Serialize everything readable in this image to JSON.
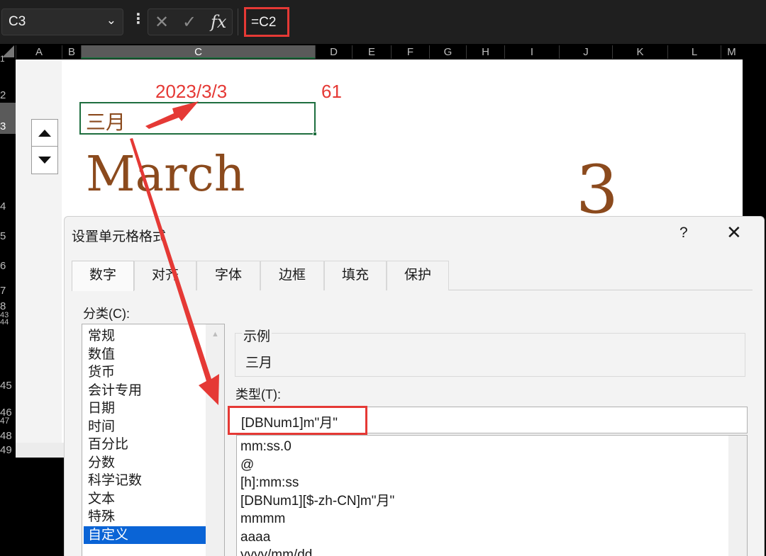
{
  "formula_bar": {
    "name_box": "C3",
    "cancel_glyph": "✕",
    "enter_glyph": "✓",
    "fx_label": "fx",
    "formula": "=C2"
  },
  "grid": {
    "column_headers": [
      "A",
      "B",
      "C",
      "D",
      "E",
      "F",
      "G",
      "H",
      "I",
      "J",
      "K",
      "L",
      "M"
    ],
    "row_headers": [
      "1",
      "2",
      "3",
      "4",
      "5",
      "6",
      "7",
      "8",
      "43",
      "44",
      "45",
      "46",
      "47",
      "48",
      "49"
    ],
    "selected_column": "C",
    "selected_row": "3",
    "cells": {
      "c2": "2023/3/3",
      "d2": "61",
      "c3": "三月",
      "march": "March",
      "big_number": "3"
    }
  },
  "dialog": {
    "title": "设置单元格格式",
    "help": "?",
    "close": "✕",
    "tabs": [
      "数字",
      "对齐",
      "字体",
      "边框",
      "填充",
      "保护"
    ],
    "active_tab": 0,
    "category_label": "分类(C):",
    "categories": [
      "常规",
      "数值",
      "货币",
      "会计专用",
      "日期",
      "时间",
      "百分比",
      "分数",
      "科学记数",
      "文本",
      "特殊",
      "自定义"
    ],
    "selected_category": 11,
    "sample_label": "示例",
    "sample_value": "三月",
    "type_label": "类型(T):",
    "type_value": "[DBNum1]m\"月\"",
    "format_list": [
      "mm:ss.0",
      "@",
      "[h]:mm:ss",
      "[DBNum1][$-zh-CN]m\"月\"",
      "mmmm",
      "aaaa",
      "yyyy/mm/dd"
    ]
  },
  "colors": {
    "annotation_red": "#e53935",
    "cell_text_brown": "#8b4a1d",
    "selection_blue": "#0a64d6",
    "excel_green": "#1e6e3f"
  }
}
